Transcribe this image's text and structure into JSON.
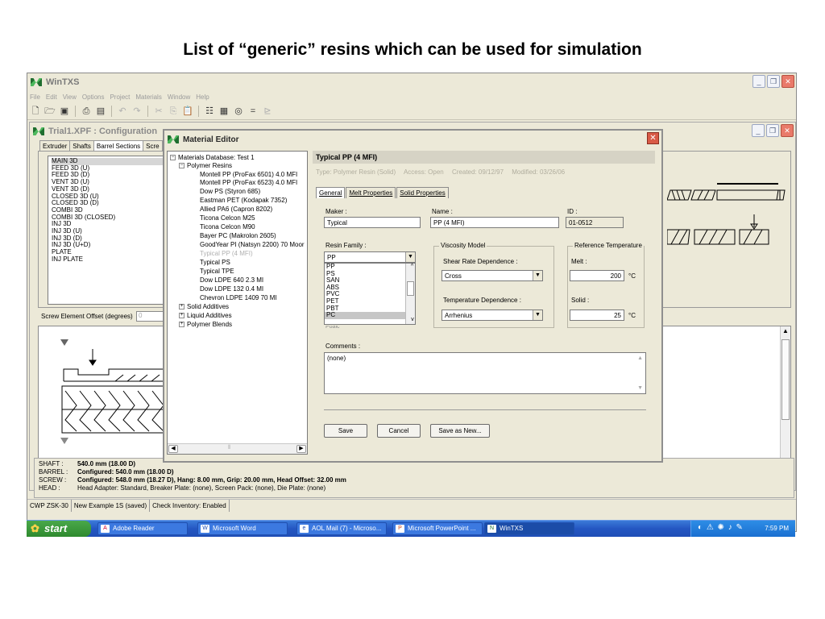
{
  "slide": {
    "title": "List of “generic” resins which can be used for simulation"
  },
  "app": {
    "title": "WinTXS",
    "menu": [
      "File",
      "Edit",
      "View",
      "Options",
      "Project",
      "Materials",
      "Window",
      "Help"
    ]
  },
  "child": {
    "title": "Trial1.XPF : Configuration",
    "tabs": [
      "Extruder",
      "Shafts",
      "Barrel Sections",
      "Scre"
    ],
    "plots": [
      "MAIN 3D",
      "FEED 3D (U)",
      "FEED 3D (D)",
      "VENT 3D (U)",
      "VENT 3D (D)",
      "CLOSED 3D (U)",
      "CLOSED 3D (D)",
      "COMBI 3D",
      "COMBI 3D (CLOSED)",
      "INJ 3D",
      "INJ 3D (U)",
      "INJ 3D (D)",
      "INJ 3D (U+D)",
      "PLATE",
      "INJ PLATE"
    ],
    "offset_label": "Screw Element Offset (degrees)",
    "offset_value": "0"
  },
  "status": {
    "shaft_key": "SHAFT :",
    "shaft_val": "540.0 mm (18.00 D)",
    "barrel_key": "BARREL :",
    "barrel_val": "Configured: 540.0 mm (18.00 D)",
    "screw_key": "SCREW :",
    "screw_val": "Configured: 548.0 mm (18.27 D), Hang: 8.00 mm, Grip: 20.00 mm, Head Offset: 32.00 mm",
    "head_key": "HEAD :",
    "head_val": "Head Adapter: Standard, Breaker Plate: (none), Screen Pack: (none), Die Plate: (none)"
  },
  "statusbar": [
    "CWP ZSK-30",
    "New Example 1S (saved)",
    "Check Inventory: Enabled"
  ],
  "dialog": {
    "title": "Material Editor",
    "tree": {
      "root": "Materials Database: Test 1",
      "polymer_resins": "Polymer Resins",
      "items": [
        "Montell PP (ProFax 6501)  4.0 MFI",
        "Montell PP (ProFax 6523)  4.0 MFI",
        "Dow PS (Styron 685)",
        "Eastman PET (Kodapak 7352)",
        "Allied PA6 (Capron 8202)",
        "Ticona Celcon M25",
        "Ticona Celcon M90",
        "Bayer PC (Makrolon 2605)",
        "GoodYear PI (Natsyn 2200)  70 Moor",
        "Typical PP (4 MFI)",
        "Typical PS",
        "Typical TPE",
        "Dow LDPE 640  2.3 MI",
        "Dow LDPE 132  0.4 MI",
        "Chevron LDPE 1409  70 MI"
      ],
      "groups": [
        "Solid Additives",
        "Liquid Additives",
        "Polymer Blends"
      ]
    },
    "header": "Typical PP (4 MFI)",
    "type": "Type: Polymer Resin (Solid)",
    "access": "Access: Open",
    "created": "Created: 09/12/97",
    "modified": "Modified: 03/26/06",
    "tabs": [
      "General",
      "Melt Properties",
      "Solid Properties"
    ],
    "maker_label": "Maker :",
    "maker_value": "Typical",
    "name_label": "Name :",
    "name_value": "PP (4 MFI)",
    "id_label": "ID :",
    "id_value": "01-0512",
    "family_label": "Resin Family :",
    "family_value": "PP",
    "family_options": [
      "PP",
      "PS",
      "SAN",
      "ABS",
      "PVC",
      "PET",
      "PBT",
      "PC"
    ],
    "family_peek": "Poalc",
    "viscosity_legend": "Viscosity Model",
    "shear_label": "Shear Rate Dependence :",
    "shear_value": "Cross",
    "temp_label": "Temperature Dependence :",
    "temp_value": "Arrhenius",
    "ref_legend": "Reference Temperature",
    "melt_label": "Melt :",
    "melt_value": "200",
    "melt_unit": "°C",
    "solid_label": "Solid :",
    "solid_value": "25",
    "solid_unit": "°C",
    "comments_label": "Comments :",
    "comments_value": "(none)",
    "save": "Save",
    "cancel": "Cancel",
    "save_new": "Save as New..."
  },
  "taskbar": {
    "start": "start",
    "tasks": [
      "Adobe Reader",
      "Microsoft Word",
      "AOL Mail (7) - Microso...",
      "Microsoft PowerPoint ...",
      "WinTXS"
    ],
    "time": "7:59 PM"
  }
}
